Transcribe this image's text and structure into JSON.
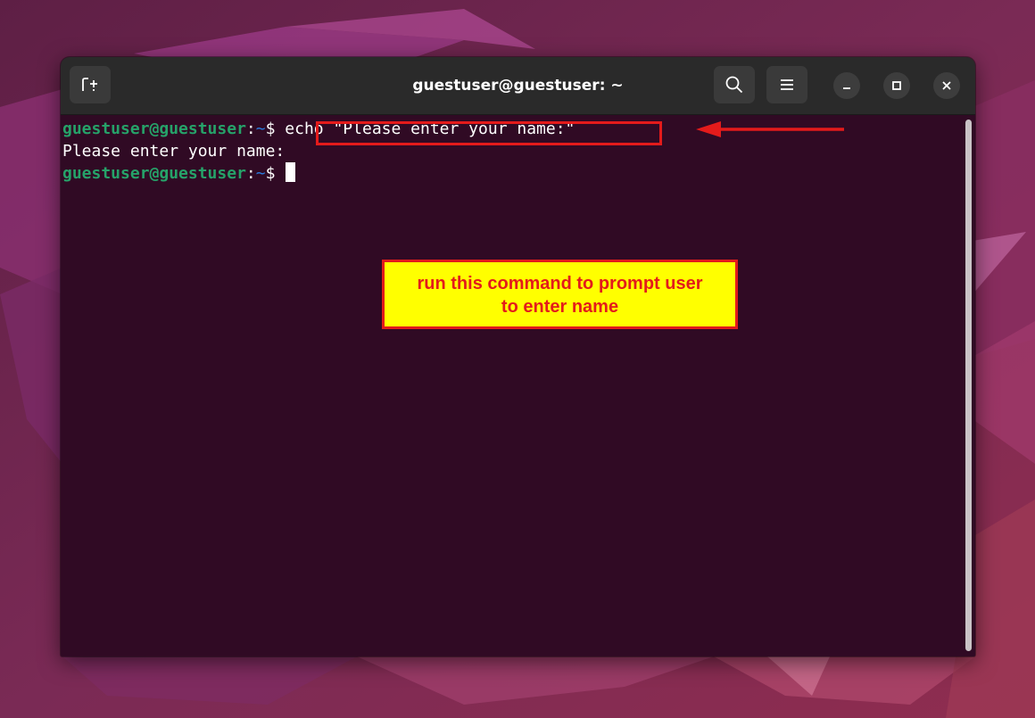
{
  "window": {
    "title": "guestuser@guestuser: ~"
  },
  "titlebar": {
    "new_tab_icon": "new-tab-icon",
    "search_icon": "search-icon",
    "menu_icon": "hamburger-menu-icon",
    "minimize_icon": "minimize-icon",
    "maximize_icon": "maximize-icon",
    "close_icon": "close-icon"
  },
  "terminal": {
    "lines": [
      {
        "prompt_user": "guestuser@guestuser",
        "prompt_colon": ":",
        "prompt_path": "~",
        "prompt_dollar": "$ ",
        "command": "echo \"Please enter your name:\""
      },
      {
        "output": "Please enter your name:"
      },
      {
        "prompt_user": "guestuser@guestuser",
        "prompt_colon": ":",
        "prompt_path": "~",
        "prompt_dollar": "$ "
      }
    ]
  },
  "annotation": {
    "callout_line1": "run this command to prompt user",
    "callout_line2": "to enter name",
    "accent_red": "#e31b1b",
    "callout_bg": "#ffff00"
  },
  "colors": {
    "terminal_bg": "#300a24",
    "prompt_user": "#26a269",
    "prompt_path": "#2a7bde",
    "titlebar_bg": "#2a2a2a"
  }
}
